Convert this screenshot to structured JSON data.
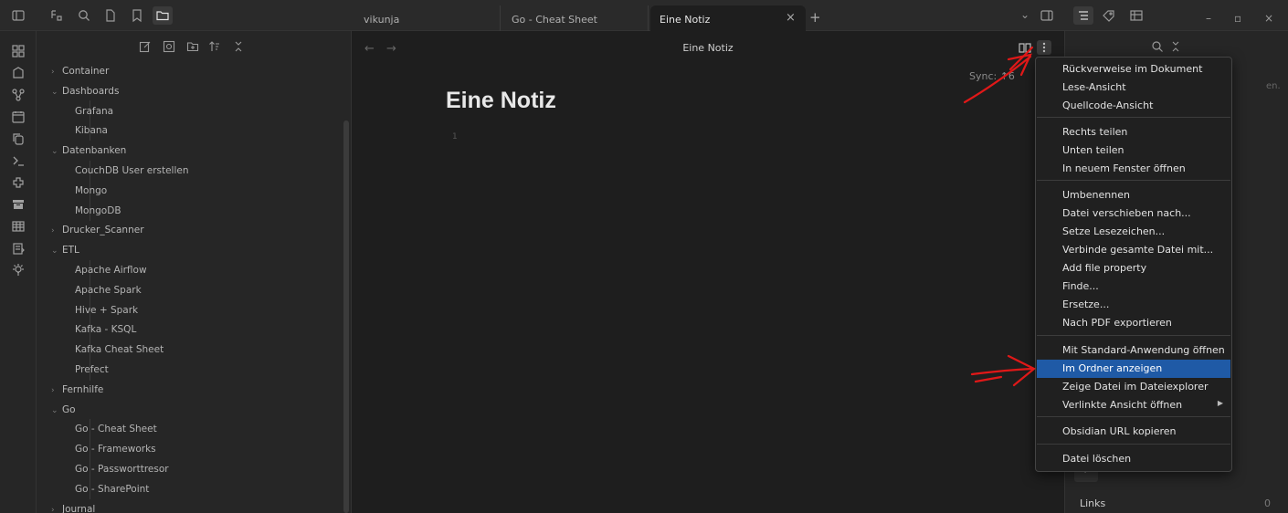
{
  "tabs": [
    {
      "label": "vikunja"
    },
    {
      "label": "Go - Cheat Sheet"
    },
    {
      "label": "Eine Notiz"
    }
  ],
  "tab_close_glyph": "×",
  "tab_plus_glyph": "+",
  "window_buttons": {
    "dropdown": "⌄",
    "minimize": "–",
    "maximize": "▫",
    "close": "×"
  },
  "explorer": {
    "tree": [
      {
        "type": "folder",
        "chev": "›",
        "label": "Container"
      },
      {
        "type": "folder",
        "chev": "⌄",
        "label": "Dashboards"
      },
      {
        "type": "file",
        "label": "Grafana"
      },
      {
        "type": "file",
        "label": "Kibana"
      },
      {
        "type": "folder",
        "chev": "⌄",
        "label": "Datenbanken"
      },
      {
        "type": "file",
        "label": "CouchDB User erstellen"
      },
      {
        "type": "file",
        "label": "Mongo"
      },
      {
        "type": "file",
        "label": "MongoDB"
      },
      {
        "type": "folder",
        "chev": "›",
        "label": "Drucker_Scanner"
      },
      {
        "type": "folder",
        "chev": "⌄",
        "label": "ETL"
      },
      {
        "type": "file",
        "label": "Apache Airflow"
      },
      {
        "type": "file",
        "label": "Apache Spark"
      },
      {
        "type": "file",
        "label": "Hive + Spark"
      },
      {
        "type": "file",
        "label": "Kafka - KSQL"
      },
      {
        "type": "file",
        "label": "Kafka Cheat Sheet"
      },
      {
        "type": "file",
        "label": "Prefect"
      },
      {
        "type": "folder",
        "chev": "›",
        "label": "Fernhilfe"
      },
      {
        "type": "folder",
        "chev": "⌄",
        "label": "Go"
      },
      {
        "type": "file",
        "label": "Go - Cheat Sheet"
      },
      {
        "type": "file",
        "label": "Go - Frameworks"
      },
      {
        "type": "file",
        "label": "Go - Passworttresor"
      },
      {
        "type": "file",
        "label": "Go - SharePoint"
      },
      {
        "type": "folder",
        "chev": "›",
        "label": "Journal"
      }
    ]
  },
  "editor": {
    "nav_back": "←",
    "nav_forward": "→",
    "view_title": "Eine Notiz",
    "doc_title": "Eine Notiz",
    "line_number": "1",
    "sync_status": "Sync: ↑6"
  },
  "context_menu": {
    "items": [
      {
        "label": "Rückverweise im Dokument"
      },
      {
        "label": "Lese-Ansicht"
      },
      {
        "label": "Quellcode-Ansicht"
      },
      {
        "label": "Rechts teilen"
      },
      {
        "label": "Unten teilen"
      },
      {
        "label": "In neuem Fenster öffnen"
      },
      {
        "label": "Umbenennen"
      },
      {
        "label": "Datei verschieben nach..."
      },
      {
        "label": "Setze Lesezeichen..."
      },
      {
        "label": "Verbinde gesamte Datei mit..."
      },
      {
        "label": "Add file property"
      },
      {
        "label": "Finde..."
      },
      {
        "label": "Ersetze..."
      },
      {
        "label": "Nach PDF exportieren"
      },
      {
        "label": "Mit Standard-Anwendung öffnen"
      },
      {
        "label": "Im Ordner anzeigen",
        "highlighted": true
      },
      {
        "label": "Zeige Datei im Dateiexplorer"
      },
      {
        "label": "Verlinkte Ansicht öffnen",
        "submenu": "▶"
      },
      {
        "label": "Obsidian URL kopieren"
      },
      {
        "label": "Datei löschen"
      }
    ]
  },
  "right_panel": {
    "hint_fragment": "en.",
    "arrow_label": "↪",
    "links_label": "Links",
    "links_count": "0"
  },
  "colors": {
    "accent_highlight": "#1f5aa6",
    "annotation_red": "#e01818",
    "background": "#1e1e1e",
    "panel": "#262626"
  },
  "icons": {
    "titlebar": [
      "sidebar-toggle-icon",
      "tags-icon",
      "search-icon",
      "file-icon",
      "bookmark-icon",
      "folder-icon"
    ],
    "ribbon": [
      "switcher-icon",
      "graph-icon",
      "canvas-icon",
      "calendar-icon",
      "copy-icon",
      "terminal-icon",
      "plugin-icon",
      "archive-icon",
      "table-icon",
      "clipboard-icon",
      "lightbulb-icon"
    ],
    "explorer_tools": [
      "new-note-icon",
      "new-drawing-icon",
      "new-folder-icon",
      "sort-icon",
      "collapse-icon"
    ]
  }
}
